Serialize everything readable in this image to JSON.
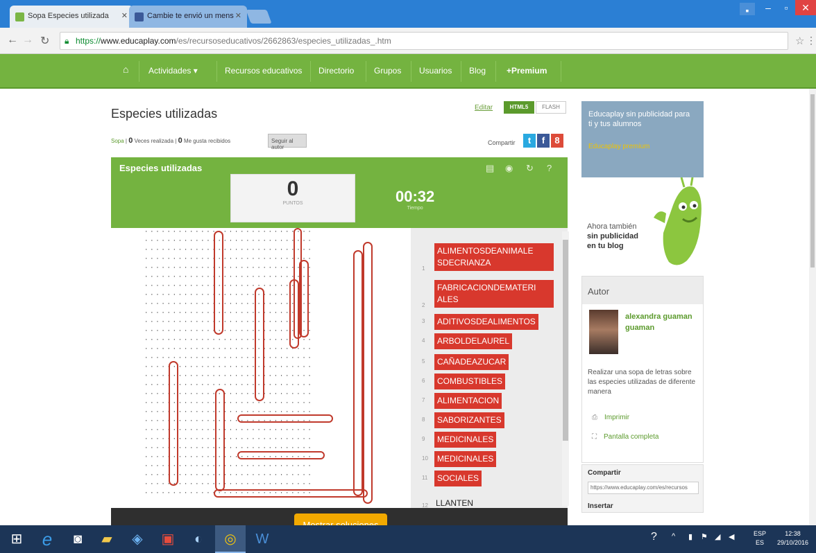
{
  "browser": {
    "tabs": [
      {
        "title": "Sopa Especies utilizada",
        "active": true
      },
      {
        "title": "Cambie te envió un mens",
        "active": false
      }
    ],
    "url_scheme": "https://",
    "url_domain": "www.educaplay.com",
    "url_path": "/es/recursoseducativos/2662863/especies_utilizadas_.htm"
  },
  "site_nav": {
    "home_icon": "home-icon",
    "items": [
      "Actividades ▾",
      "Recursos educativos",
      "Directorio",
      "Grupos",
      "Usuarios",
      "Blog",
      "+Premium"
    ]
  },
  "page": {
    "title": "Especies utilizadas",
    "meta_type": "Sopa",
    "views_count": "0",
    "views_label": "Veces realizada",
    "likes_count": "0",
    "likes_label": "Me gusta recibidos",
    "follow_label": "Seguir al autor",
    "edit_label": "Editar",
    "format_html5": "HTML5",
    "format_flash": "FLASH",
    "share_label": "Compartir",
    "share_twitter": "t",
    "share_facebook": "f",
    "share_google": "8"
  },
  "game": {
    "title": "Especies utilizadas",
    "score": "0",
    "score_label": "PUNTOS",
    "time": "00:32",
    "time_label": "Tiempo",
    "show_solutions_label": "Mostrar soluciones",
    "words": [
      {
        "num": "1",
        "text": "ALIMENTOSDEANIMALE SDECRIANZA",
        "found": true
      },
      {
        "num": "2",
        "text": "FABRICACIONDEMATERI ALES",
        "found": true
      },
      {
        "num": "3",
        "text": "ADITIVOSDEALIMENTOS",
        "found": true
      },
      {
        "num": "4",
        "text": "ARBOLDELAUREL",
        "found": true
      },
      {
        "num": "5",
        "text": "CAÑADEAZUCAR",
        "found": true
      },
      {
        "num": "6",
        "text": "COMBUSTIBLES",
        "found": true
      },
      {
        "num": "7",
        "text": "ALIMENTACION",
        "found": true
      },
      {
        "num": "8",
        "text": "SABORIZANTES",
        "found": true
      },
      {
        "num": "9",
        "text": "MEDICINALES",
        "found": true
      },
      {
        "num": "10",
        "text": "MEDICINALES",
        "found": true
      },
      {
        "num": "11",
        "text": "SOCIALES",
        "found": true
      },
      {
        "num": "12",
        "text": "LLANTEN",
        "found": false
      }
    ]
  },
  "sidebar": {
    "ad_text": "Educaplay sin publicidad para ti y tus alumnos",
    "ad_premium": "Educaplay premium",
    "tagline_1": "Ahora también",
    "tagline_2": "sin publicidad",
    "tagline_3": "en tu blog",
    "author_header": "Autor",
    "author_name": "alexandra guaman guaman",
    "author_desc": "Realizar una sopa de letras sobre las especies utilizadas de diferente manera",
    "print_label": "Imprimir",
    "fullscreen_label": "Pantalla completa",
    "share_header": "Compartir",
    "share_url": "https://www.educaplay.com/es/recursos",
    "insert_header": "Insertar"
  },
  "taskbar": {
    "lang_top": "ESP",
    "lang_bottom": "ES",
    "time": "12:38",
    "date": "29/10/2016"
  }
}
